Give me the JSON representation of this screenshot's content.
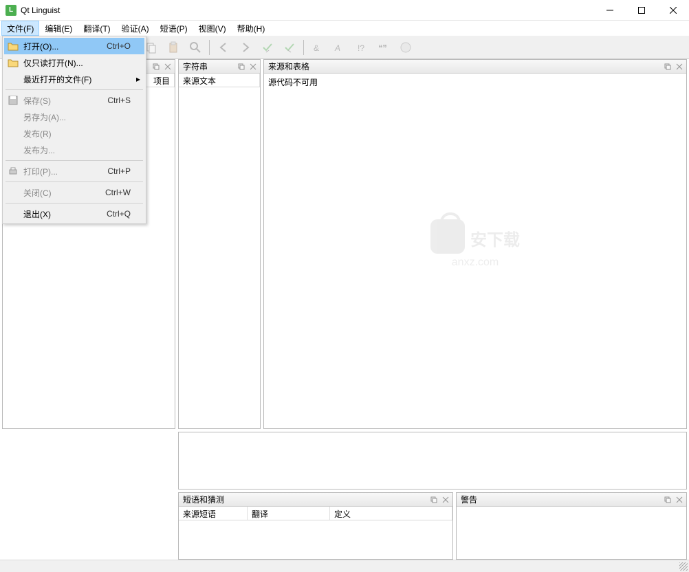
{
  "app": {
    "title": "Qt Linguist",
    "icon_letter": "L"
  },
  "menubar": [
    "文件(F)",
    "编辑(E)",
    "翻译(T)",
    "验证(A)",
    "短语(P)",
    "视图(V)",
    "帮助(H)"
  ],
  "file_menu": {
    "open": {
      "label": "打开(O)...",
      "shortcut": "Ctrl+O"
    },
    "open_readonly": {
      "label": "仅只读打开(N)..."
    },
    "recent": {
      "label": "最近打开的文件(F)"
    },
    "save": {
      "label": "保存(S)",
      "shortcut": "Ctrl+S"
    },
    "saveas": {
      "label": "另存为(A)..."
    },
    "release": {
      "label": "发布(R)"
    },
    "releaseas": {
      "label": "发布为..."
    },
    "print": {
      "label": "打印(P)...",
      "shortcut": "Ctrl+P"
    },
    "close": {
      "label": "关闭(C)",
      "shortcut": "Ctrl+W"
    },
    "exit": {
      "label": "退出(X)",
      "shortcut": "Ctrl+Q"
    }
  },
  "panels": {
    "context": {
      "title": "",
      "col_items": "项目"
    },
    "strings": {
      "title": "字符串",
      "col_source": "来源文本"
    },
    "source": {
      "title": "来源和表格",
      "content": "源代码不可用"
    },
    "phrases": {
      "title": "短语和猜测",
      "col_source": "来源短语",
      "col_trans": "翻译",
      "col_def": "定义"
    },
    "warnings": {
      "title": "警告"
    }
  },
  "watermark": {
    "main": "安下载",
    "sub": "anxz.com"
  }
}
